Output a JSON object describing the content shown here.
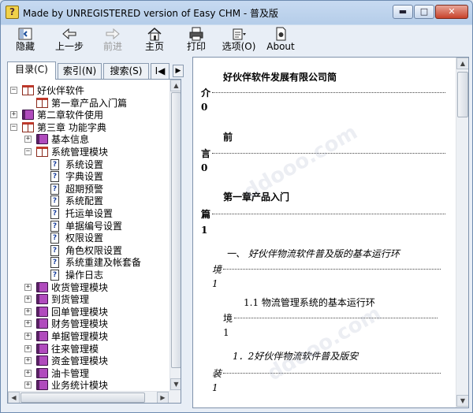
{
  "window": {
    "title": "Made by UNREGISTERED version of Easy CHM - 普及版",
    "app_icon_glyph": "?",
    "min_glyph": "▬",
    "max_glyph": "□",
    "close_glyph": "✕"
  },
  "toolbar": {
    "hide": "隐藏",
    "back": "上一步",
    "forward": "前进",
    "home": "主页",
    "print": "打印",
    "options": "选项(O)",
    "about": "About"
  },
  "tabs": {
    "contents": "目录(C)",
    "index": "索引(N)",
    "search": "搜索(S)",
    "more": "I◀",
    "scroll": "▶"
  },
  "tree": [
    {
      "label": "好伙伴软件",
      "icon": "book-open",
      "expander": "−"
    },
    {
      "label": "第一章产品入门篇",
      "icon": "book-open"
    },
    {
      "label": "第二章软件使用",
      "icon": "book-closed",
      "expander": "+"
    },
    {
      "label": "第三章  功能字典",
      "icon": "book-open",
      "expander": "−"
    },
    {
      "label": "基本信息",
      "icon": "book-closed",
      "expander": "+"
    },
    {
      "label": "系统管理模块",
      "icon": "book-open",
      "expander": "−"
    },
    {
      "label": "系统设置",
      "icon": "page"
    },
    {
      "label": "字典设置",
      "icon": "page"
    },
    {
      "label": "超期预警",
      "icon": "page"
    },
    {
      "label": "系统配置",
      "icon": "page"
    },
    {
      "label": "托运单设置",
      "icon": "page"
    },
    {
      "label": "单据编号设置",
      "icon": "page"
    },
    {
      "label": "权限设置",
      "icon": "page"
    },
    {
      "label": "角色权限设置",
      "icon": "page"
    },
    {
      "label": "系统重建及帐套备",
      "icon": "page"
    },
    {
      "label": "操作日志",
      "icon": "page"
    },
    {
      "label": "收货管理模块",
      "icon": "book-closed",
      "expander": "+"
    },
    {
      "label": "到货管理",
      "icon": "book-closed",
      "expander": "+"
    },
    {
      "label": "回单管理模块",
      "icon": "book-closed",
      "expander": "+"
    },
    {
      "label": "财务管理模块",
      "icon": "book-closed",
      "expander": "+"
    },
    {
      "label": "单据管理模块",
      "icon": "book-closed",
      "expander": "+"
    },
    {
      "label": "往来管理模",
      "icon": "book-closed",
      "expander": "+"
    },
    {
      "label": "资金管理模块",
      "icon": "book-closed",
      "expander": "+"
    },
    {
      "label": "油卡管理",
      "icon": "book-closed",
      "expander": "+"
    },
    {
      "label": "业务统计模块",
      "icon": "book-closed",
      "expander": "+"
    }
  ],
  "page_glyph": "?",
  "document": {
    "company_title": "好伙伴软件发展有限公司简",
    "company_title_cont": "介",
    "company_page": "0",
    "preface": "前",
    "preface_cont": "言",
    "preface_page": "0",
    "chapter1": "第一章产品入门",
    "chapter1_cont": "篇",
    "chapter1_page": "1",
    "section1": "一、   好伙伴物流软件普及版的基本运行环",
    "section1_cont": "境",
    "section1_page": "1",
    "sub11": "1.1 物流管理系统的基本运行环",
    "sub11_cont": "境",
    "sub11_page": "1",
    "sub12": "1．2好伙伴物流软件普及版安",
    "sub12_cont": "装",
    "sub12_page": "1"
  },
  "scroll": {
    "up": "▲",
    "down": "▼",
    "left": "◀",
    "right": "▶"
  }
}
